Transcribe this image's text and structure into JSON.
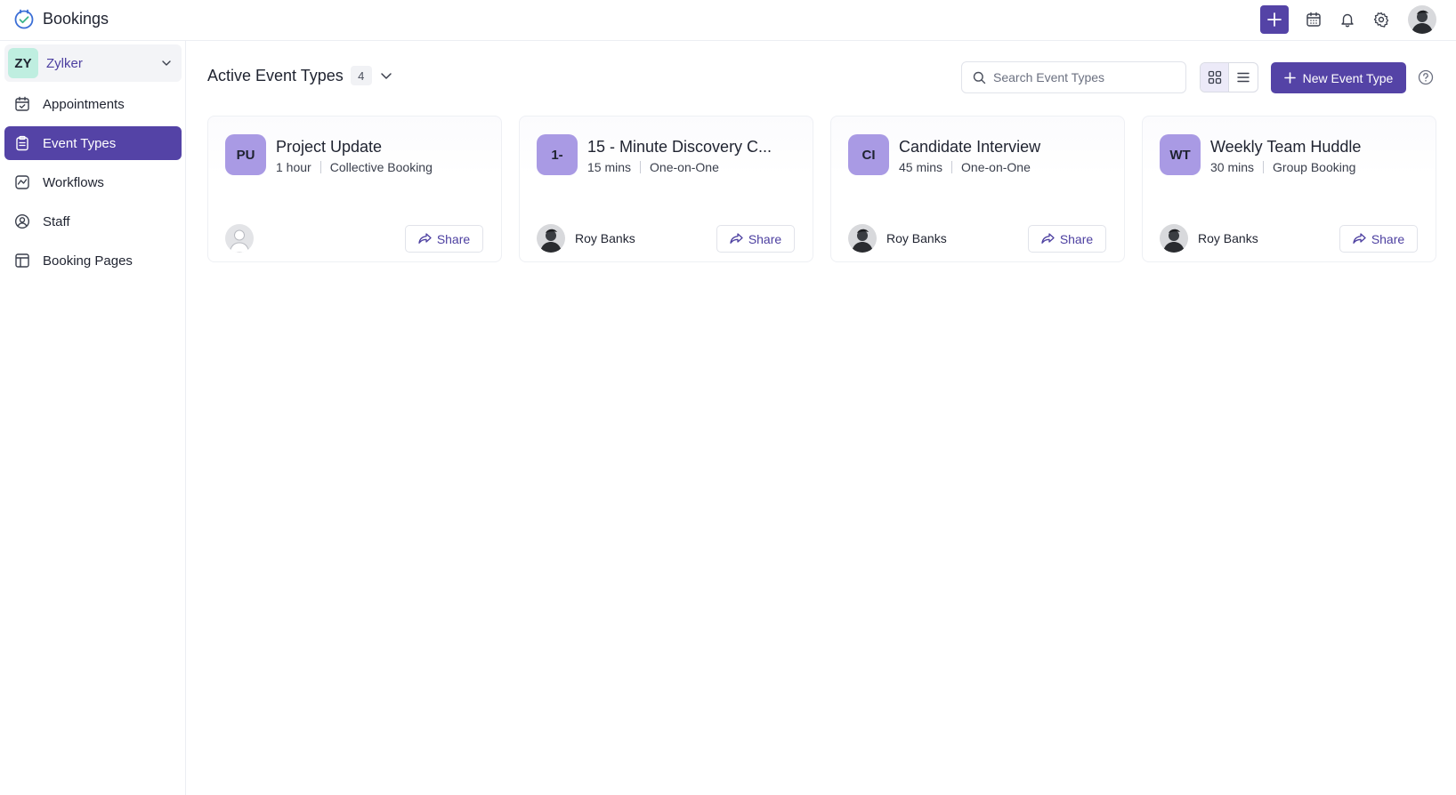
{
  "app": {
    "title": "Bookings"
  },
  "topbar": {
    "icons": [
      "plus-icon",
      "calendar-icon",
      "bell-icon",
      "gear-icon",
      "user-avatar"
    ],
    "accent": "#5443a6"
  },
  "sidebar": {
    "org": {
      "badge": "ZY",
      "name": "Zylker"
    },
    "items": [
      {
        "label": "Appointments",
        "icon": "calendar-check-icon",
        "active": false
      },
      {
        "label": "Event Types",
        "icon": "clipboard-icon",
        "active": true
      },
      {
        "label": "Workflows",
        "icon": "workflow-icon",
        "active": false
      },
      {
        "label": "Staff",
        "icon": "user-circle-icon",
        "active": false
      },
      {
        "label": "Booking Pages",
        "icon": "layout-icon",
        "active": false
      }
    ]
  },
  "main": {
    "title": "Active Event Types",
    "count": "4",
    "search": {
      "placeholder": "Search Event Types",
      "value": ""
    },
    "new_button": "New Event Type",
    "view": "grid"
  },
  "cards": [
    {
      "badge": "PU",
      "title": "Project Update",
      "duration": "1 hour",
      "kind": "Collective Booking",
      "owner": "",
      "owner_avatar": "placeholder",
      "share": "Share"
    },
    {
      "badge": "1-",
      "title": "15 - Minute Discovery C...",
      "duration": "15 mins",
      "kind": "One-on-One",
      "owner": "Roy Banks",
      "owner_avatar": "photo",
      "share": "Share"
    },
    {
      "badge": "CI",
      "title": "Candidate Interview",
      "duration": "45 mins",
      "kind": "One-on-One",
      "owner": "Roy Banks",
      "owner_avatar": "photo",
      "share": "Share"
    },
    {
      "badge": "WT",
      "title": "Weekly Team Huddle",
      "duration": "30 mins",
      "kind": "Group Booking",
      "owner": "Roy Banks",
      "owner_avatar": "photo",
      "share": "Share"
    }
  ]
}
